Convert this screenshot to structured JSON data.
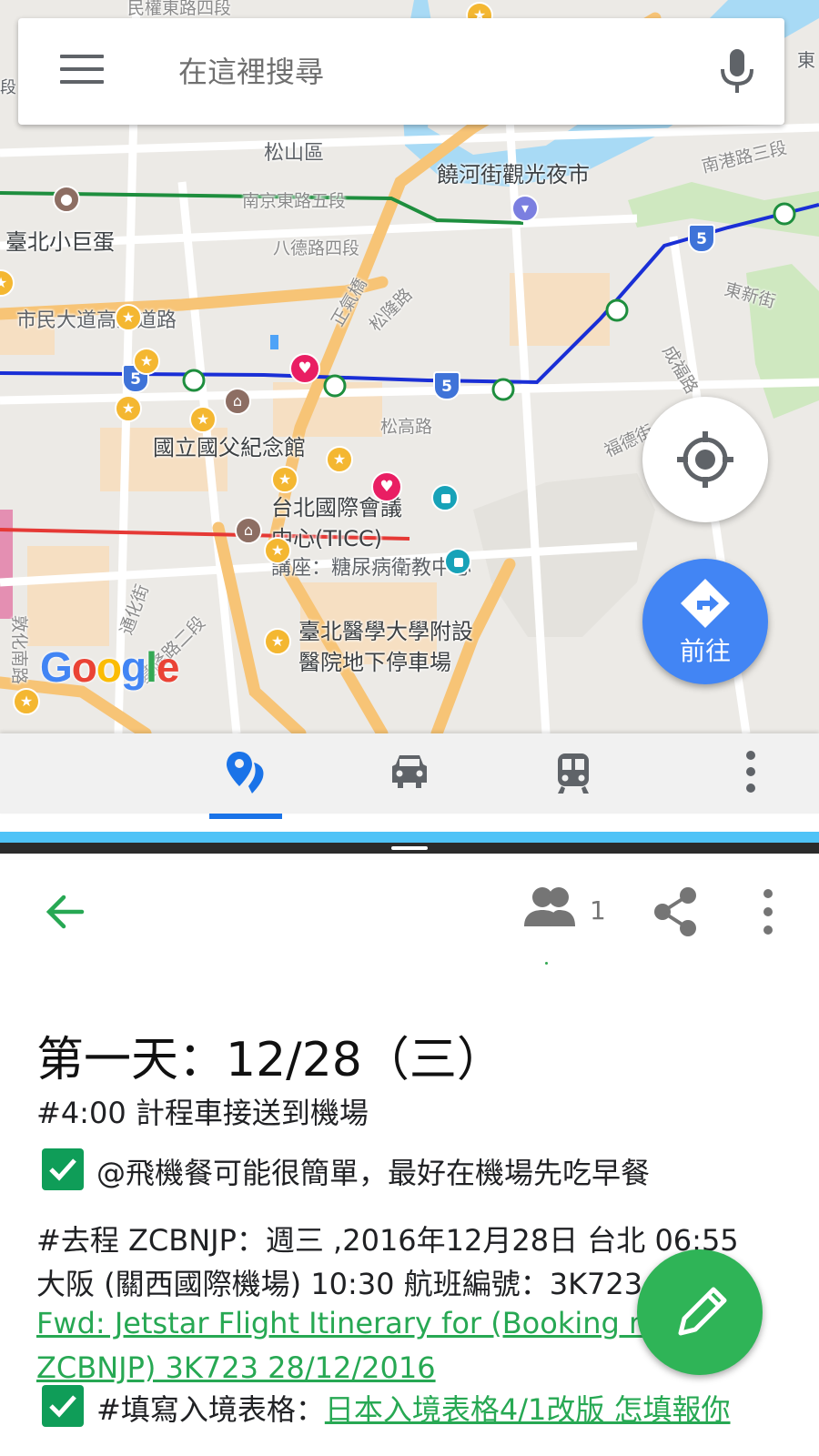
{
  "search": {
    "placeholder": "在這裡搜尋"
  },
  "map": {
    "labels": {
      "minquan": "民權東路四段",
      "songshan": "松山區",
      "raohe": "饒河街觀光夜市",
      "nangang": "南港路三段",
      "nanjing": "南京東路五段",
      "giant_egg": "臺北小巨蛋",
      "bade": "八德路四段",
      "civic": "市民大道高架道路",
      "zhengqi": "正氣橋",
      "songlong": "松隆路",
      "dongxin": "東新街",
      "chenggong": "成福路",
      "fude": "福德街",
      "songgao": "松高路",
      "sun_yatsen": "國立國父紀念館",
      "ticc_1": "台北國際會議",
      "ticc_2": "中心(TICC)",
      "diabetes": "講座：糖尿病衛教中心",
      "dunhua": "敦化南路",
      "tonghua": "通化街",
      "keelung": "基隆路二段",
      "tmu_1": "臺北醫學大學附設",
      "tmu_2": "醫院地下停車場",
      "dong_top": "東",
      "duan": "段",
      "shield": "5"
    },
    "go_label": "前往",
    "logo": [
      "G",
      "o",
      "o",
      "g",
      "l",
      "e"
    ],
    "logo_colors": [
      "#4285f4",
      "#ea4335",
      "#fbbc05",
      "#4285f4",
      "#34a853",
      "#ea4335"
    ]
  },
  "tabs": [
    {
      "name": "places",
      "icon": "map-pins-icon",
      "active": true
    },
    {
      "name": "driving",
      "icon": "car-icon",
      "active": false
    },
    {
      "name": "transit",
      "icon": "train-icon",
      "active": false
    },
    {
      "name": "more",
      "icon": "more-vert-icon",
      "active": false
    }
  ],
  "note": {
    "collaborators": "1",
    "title": "第一天：12/28（三）",
    "taxi": "#4:00 計程車接送到機場",
    "breakfast": "@飛機餐可能很簡單，最好在機場先吃早餐",
    "flight_1": "#去程 ZCBNJP：週三 ,2016年12月28日 台北 06:55",
    "flight_2": " 大阪 (關西國際機場) 10:30 航班編號：3K723",
    "link_1": "Fwd: Jetstar Flight Itinerary for (Booking ref",
    "link_2": "ZCBNJP) 3K723 28/12/2016",
    "entry_prefix": "#填寫入境表格：",
    "entry_link": "日本入境表格4/1改版 怎填報你"
  },
  "colors": {
    "accent_blue": "#4285f4",
    "note_green": "#27a853",
    "fab_green": "#2fb457",
    "checkbox_green": "#0f9d58",
    "mrt_blue": "#1a2fd6",
    "mrt_green": "#1e8e3e",
    "mrt_red": "#e53935",
    "road_orange": "#f7c476"
  }
}
